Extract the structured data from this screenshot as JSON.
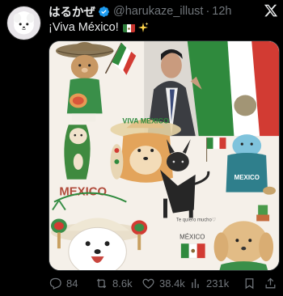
{
  "tweet": {
    "display_name": "はるかぜ",
    "handle": "@harukaze_illust",
    "separator": "·",
    "time": "12h",
    "text": "¡Viva México!",
    "verified": true
  },
  "media": {
    "labels": {
      "sombrero_text": "VIVA MEXICO",
      "banner_text": "MEXICO",
      "mascot_text": "MEXICO",
      "note_text": "Te quiero mucho♡",
      "card_text": "MÉXICO"
    }
  },
  "actions": {
    "replies": "84",
    "reposts": "8.6k",
    "likes": "38.4k",
    "views": "231k"
  },
  "colors": {
    "background": "#000000",
    "text": "#e7e9ea",
    "muted": "#71767b",
    "verified": "#1d9bf0",
    "flag_green": "#2e7d3a",
    "flag_red": "#c8342d"
  },
  "icons": [
    "verified-badge-icon",
    "x-logo-icon",
    "mexico-flag-emoji",
    "sparkles-emoji",
    "reply-icon",
    "repost-icon",
    "like-icon",
    "views-icon",
    "bookmark-icon",
    "share-icon"
  ]
}
